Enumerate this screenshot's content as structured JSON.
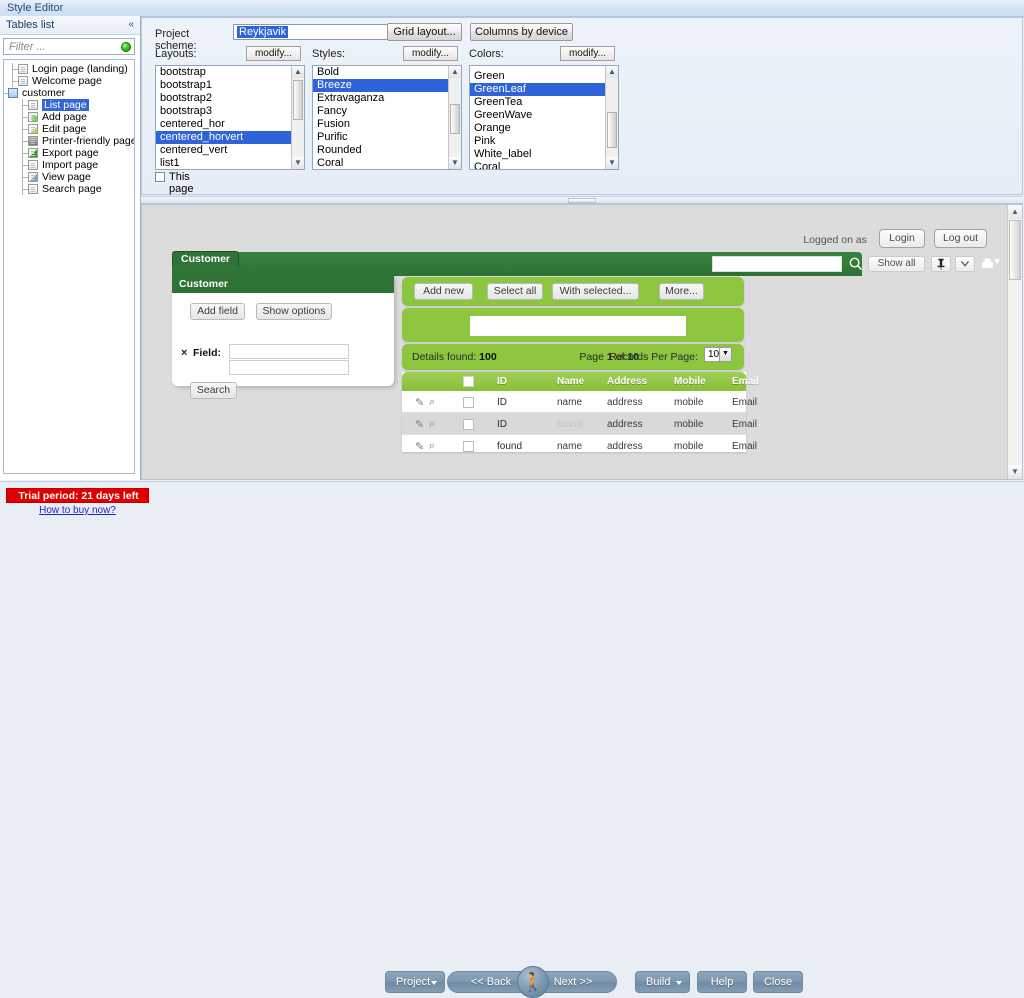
{
  "window": {
    "title": "Style Editor"
  },
  "left_panel": {
    "header": "Tables list",
    "collapse_icon": "collapse-left-icon",
    "filter_placeholder": "Filter ...",
    "status_dot": "green-status-dot-icon",
    "tree": [
      {
        "label": "Login page (landing)",
        "icon": "page-icon",
        "depth": 1,
        "selected": false
      },
      {
        "label": "Welcome page",
        "icon": "page-icon",
        "depth": 1,
        "selected": false
      },
      {
        "label": "customer",
        "icon": "folder-icon",
        "depth": 0,
        "selected": false,
        "expander": "-"
      },
      {
        "label": "List page",
        "icon": "page-icon",
        "depth": 2,
        "selected": true
      },
      {
        "label": "Add page",
        "icon": "add-page-icon",
        "depth": 2,
        "selected": false
      },
      {
        "label": "Edit page",
        "icon": "edit-page-icon",
        "depth": 2,
        "selected": false
      },
      {
        "label": "Printer-friendly page",
        "icon": "printer-icon",
        "depth": 2,
        "selected": false
      },
      {
        "label": "Export page",
        "icon": "export-icon",
        "depth": 2,
        "selected": false
      },
      {
        "label": "Import page",
        "icon": "import-icon",
        "depth": 2,
        "selected": false
      },
      {
        "label": "View page",
        "icon": "view-icon",
        "depth": 2,
        "selected": false
      },
      {
        "label": "Search page",
        "icon": "search-page-icon",
        "depth": 2,
        "selected": false
      }
    ]
  },
  "settings": {
    "scheme_label": "Project scheme:",
    "scheme_value": "Reykjavik",
    "grid_layout_button": "Grid layout...",
    "columns_by_device_button": "Columns by device",
    "layouts": {
      "label": "Layouts:",
      "modify_label": "modify...",
      "items": [
        "bootstrap",
        "bootstrap1",
        "bootstrap2",
        "bootstrap3",
        "centered_hor",
        "centered_horvert",
        "centered_vert",
        "list1"
      ],
      "selected": "centered_horvert"
    },
    "styles": {
      "label": "Styles:",
      "modify_label": "modify...",
      "items": [
        "Bold",
        "Breeze",
        "Extravaganza",
        "Fancy",
        "Fusion",
        "Purific",
        "Rounded",
        "Coral"
      ],
      "selected": "Breeze"
    },
    "colors": {
      "label": "Colors:",
      "modify_label": "modify...",
      "items": [
        "Green",
        "GreenLeaf",
        "GreenTea",
        "GreenWave",
        "Orange",
        "Pink",
        "White_label",
        "Coral"
      ],
      "selected": "GreenLeaf"
    },
    "custom_settings_checkbox": "This page has custom settings",
    "custom_settings_checked": false
  },
  "preview": {
    "logged_on_as": "Logged on as",
    "login_button": "Login",
    "logout_button": "Log out",
    "tab_label": "Customer",
    "search_value": "",
    "search_icon": "magnifier-icon",
    "show_all_button": "Show all",
    "pin_icon": "pin-icon",
    "bookmark_icon": "bookmark-icon",
    "print_icon": "print-dropdown-icon",
    "panel": {
      "title": "Customer",
      "add_field_button": "Add field",
      "show_options_button": "Show options",
      "remove_icon": "remove-x-icon",
      "field_label": "Field:",
      "field_value_1": "",
      "field_value_2": "",
      "search_button": "Search"
    },
    "toolbar": {
      "add_new": "Add new",
      "select_all": "Select all",
      "with_selected": "With selected...",
      "more": "More..."
    },
    "search_field_value": "",
    "status": {
      "details_found_label": "Details found:",
      "details_found_value": "100",
      "page_label": "Page",
      "page_current": "1",
      "page_of": "of",
      "page_total": "10",
      "records_per_page_label": "Records Per Page:",
      "records_per_page_value": "10"
    },
    "table": {
      "columns": [
        "ID",
        "Name",
        "Address",
        "Mobile",
        "Email"
      ],
      "rows": [
        {
          "id": "ID",
          "name": "name",
          "address": "address",
          "mobile": "mobile",
          "email": "Email",
          "id_dim": false,
          "name_dim": false
        },
        {
          "id": "ID",
          "name": "found",
          "address": "address",
          "mobile": "mobile",
          "email": "Email",
          "id_dim": false,
          "name_dim": true
        },
        {
          "id": "found",
          "name": "name",
          "address": "address",
          "mobile": "mobile",
          "email": "Email",
          "id_dim": true,
          "name_dim": false
        }
      ],
      "edit_icon": "edit-link-icon",
      "view_icon": "view-magnifier-icon"
    },
    "scrollbar": "preview-vertical-scrollbar"
  },
  "bottom": {
    "trial_text": "Trial period: 21 days left",
    "buy_link": "How to buy now?",
    "project_button": "Project",
    "back_button": "<< Back",
    "next_button": "Next >>",
    "run_icon": "run-person-icon",
    "build_button": "Build",
    "help_button": "Help",
    "close_button": "Close"
  },
  "colors": {
    "accent_green": "#8cc63e",
    "dark_green": "#2f7337",
    "selection_blue": "#2f63d8",
    "trial_red": "#e00000",
    "button_slate": "#7d97af"
  }
}
